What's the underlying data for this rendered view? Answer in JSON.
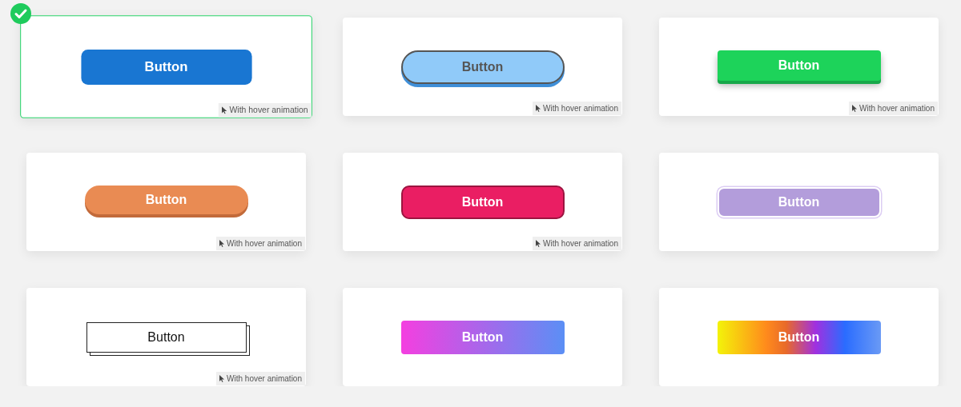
{
  "cards": [
    {
      "selected": true,
      "kind": "flat",
      "color": "#1976d2",
      "button": "Button",
      "note": "With hover animation"
    },
    {
      "selected": false,
      "kind": "outlined-pill",
      "color": "#90caf9",
      "button": "Button",
      "note": "With hover animation"
    },
    {
      "selected": false,
      "kind": "raised",
      "color": "#1dd35a",
      "button": "Button",
      "note": "With hover animation"
    },
    {
      "selected": false,
      "kind": "raised-pill",
      "color": "#e98b53",
      "button": "Button",
      "note": "With hover animation"
    },
    {
      "selected": false,
      "kind": "bordered",
      "color": "#ea1e63",
      "button": "Button",
      "note": "With hover animation"
    },
    {
      "selected": false,
      "kind": "ringed",
      "color": "#b39ddb",
      "button": "Button"
    },
    {
      "selected": false,
      "kind": "double-outline",
      "button": "Button",
      "note": "With hover animation"
    },
    {
      "selected": false,
      "kind": "gradient",
      "button": "Button"
    },
    {
      "selected": false,
      "kind": "rainbow",
      "button": "Button"
    }
  ]
}
